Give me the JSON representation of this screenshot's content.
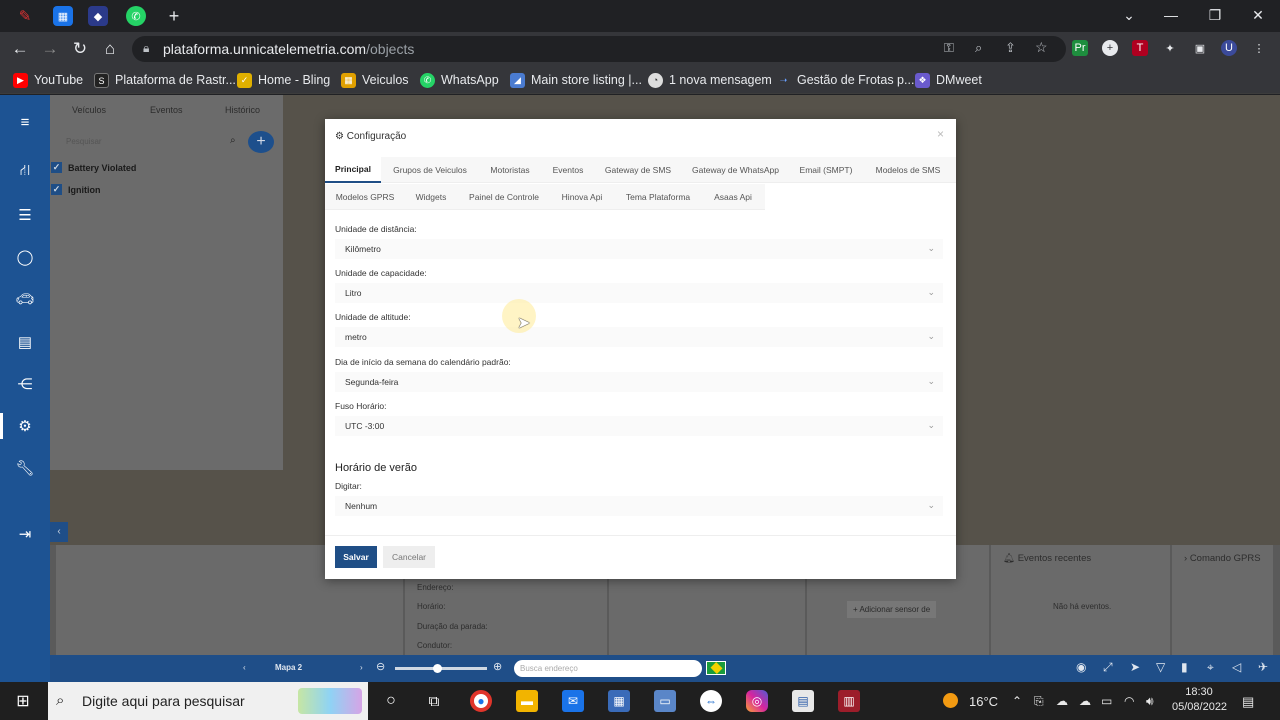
{
  "browser": {
    "url_host": "plataforma.unnicatelemetria.com",
    "url_path": "/objects",
    "new_tab": "+",
    "bookmarks": [
      {
        "label": "YouTube",
        "color": "#ff0000"
      },
      {
        "label": "Plataforma de Rastr...",
        "color": "#222222"
      },
      {
        "label": "Home - Bling",
        "color": "#e0b000"
      },
      {
        "label": "Veiculos",
        "color": "#e0a000"
      },
      {
        "label": "WhatsApp",
        "color": "#25d366"
      },
      {
        "label": "Main store listing |...",
        "color": "#4a7bd0"
      },
      {
        "label": "1 nova mensagem",
        "color": "#dddddd"
      },
      {
        "label": "Gestão de Frotas p...",
        "color": "#3b6fd8"
      },
      {
        "label": "DMweet",
        "color": "#6a5acd"
      }
    ]
  },
  "sidepanel": {
    "tabs": [
      "Veículos",
      "Eventos",
      "Histórico"
    ],
    "search_placeholder": "Pesquisar",
    "add_label": "+",
    "items": [
      "Battery Violated",
      "Ignition"
    ]
  },
  "bottom": {
    "fields": [
      "Endereço:",
      "Horário:",
      "Duração da parada:",
      "Condutor:"
    ],
    "add_sensor": "Adicionar sensor de",
    "recent_events_title": "Eventos recentes",
    "no_events": "Não há eventos.",
    "gprs_title": "Comando GPRS"
  },
  "mapbar": {
    "map_label": "Mapa 2",
    "search_placeholder": "Busca endereço"
  },
  "modal": {
    "title": "Configuração",
    "close": "×",
    "tabs_row1": [
      "Principal",
      "Grupos de Veiculos",
      "Motoristas",
      "Eventos",
      "Gateway de SMS",
      "Gateway de WhatsApp",
      "Email (SMPT)",
      "Modelos de SMS"
    ],
    "tabs_row2": [
      "Modelos GPRS",
      "Widgets",
      "Painel de Controle",
      "Hinova Api",
      "Tema Plataforma",
      "Asaas Api"
    ],
    "fields": [
      {
        "label": "Unidade de distância:",
        "value": "Kilômetro"
      },
      {
        "label": "Unidade de capacidade:",
        "value": "Litro"
      },
      {
        "label": "Unidade de altitude:",
        "value": "metro"
      },
      {
        "label": "Dia de início da semana do calendário padrão:",
        "value": "Segunda-feira"
      },
      {
        "label": "Fuso Horário:",
        "value": "UTC -3:00"
      }
    ],
    "dst_section": "Horário de verão",
    "dst_label": "Digitar:",
    "dst_value": "Nenhum",
    "save": "Salvar",
    "cancel": "Cancelar"
  },
  "taskbar": {
    "search_placeholder": "Digite aqui para pesquisar",
    "temperature": "16°C",
    "time": "18:30",
    "date": "05/08/2022"
  },
  "colors": {
    "brand": "#1d5393",
    "save": "#1f4e86"
  }
}
